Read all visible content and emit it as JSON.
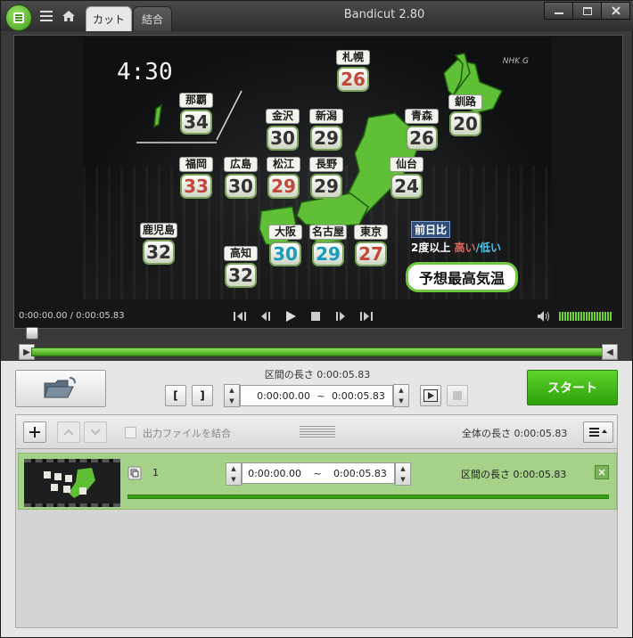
{
  "window": {
    "title": "Bandicut 2.80"
  },
  "tabs": [
    {
      "label": "カット"
    },
    {
      "label": "結合"
    }
  ],
  "video": {
    "overlay_time": "4:30",
    "channel_logo": "NHK G",
    "cities": [
      {
        "name": "札幌",
        "temp": "26",
        "tone": "high"
      },
      {
        "name": "那覇",
        "temp": "34",
        "tone": "normal"
      },
      {
        "name": "金沢",
        "temp": "30",
        "tone": "normal"
      },
      {
        "name": "新潟",
        "temp": "29",
        "tone": "normal"
      },
      {
        "name": "青森",
        "temp": "26",
        "tone": "normal"
      },
      {
        "name": "釧路",
        "temp": "20",
        "tone": "normal"
      },
      {
        "name": "福岡",
        "temp": "33",
        "tone": "high"
      },
      {
        "name": "広島",
        "temp": "30",
        "tone": "normal"
      },
      {
        "name": "松江",
        "temp": "29",
        "tone": "high"
      },
      {
        "name": "長野",
        "temp": "29",
        "tone": "normal"
      },
      {
        "name": "仙台",
        "temp": "24",
        "tone": "normal"
      },
      {
        "name": "鹿児島",
        "temp": "32",
        "tone": "normal"
      },
      {
        "name": "高知",
        "temp": "32",
        "tone": "normal"
      },
      {
        "name": "大阪",
        "temp": "30",
        "tone": "cool"
      },
      {
        "name": "名古屋",
        "temp": "29",
        "tone": "cool"
      },
      {
        "name": "東京",
        "temp": "27",
        "tone": "high"
      }
    ],
    "legend_title": "前日比",
    "legend_prefix": "2度以上",
    "legend_high": "高い",
    "legend_sep": "/",
    "legend_low": "低い",
    "forecast_label": "予想最高気温"
  },
  "player": {
    "timecode": "0:00:00.00 / 0:00:05.83",
    "volume_level": 1.0
  },
  "controls": {
    "segment_length_label": "区間の長さ 0:00:05.83",
    "mark_start": "[",
    "mark_end": "]",
    "range_start": "0:00:00.00",
    "range_sep": "~",
    "range_end": "0:00:05.83",
    "start_button": "スタート"
  },
  "list": {
    "merge_label": "出力ファイルを結合",
    "total_length": "全体の長さ 0:00:05.83",
    "rows": [
      {
        "index": "1",
        "range_start": "0:00:00.00",
        "range_sep": "~",
        "range_end": "0:00:05.83",
        "length": "区間の長さ 0:00:05.83"
      }
    ]
  },
  "colors": {
    "accent_green": "#3fa31a",
    "temp_high": "#c3473b",
    "temp_cool": "#1a9ac0"
  }
}
